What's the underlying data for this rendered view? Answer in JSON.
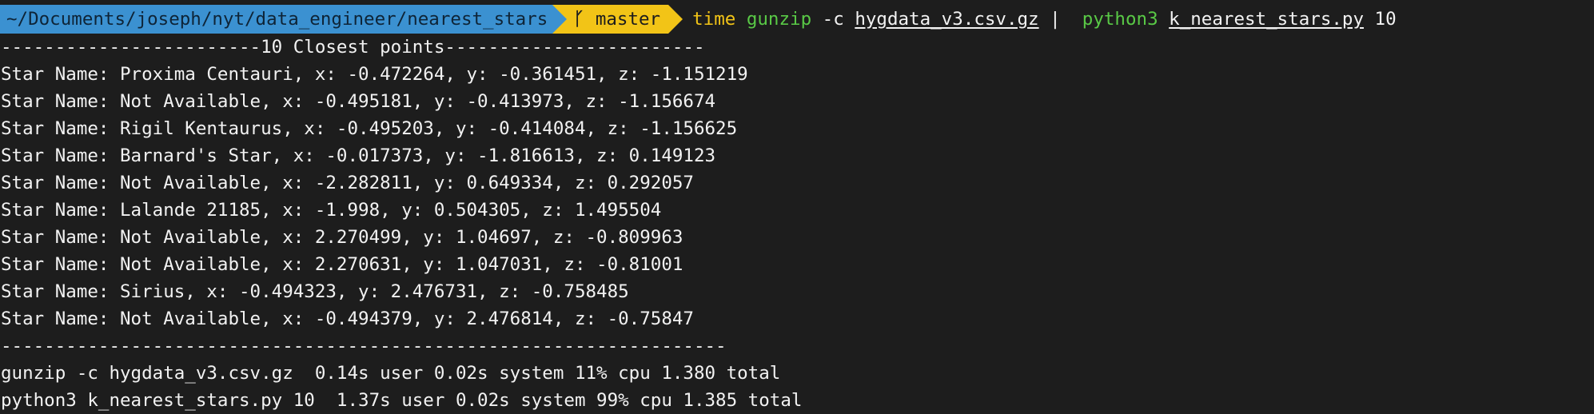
{
  "prompt": {
    "path": "~/Documents/joseph/nyt/data_engineer/nearest_stars",
    "branch": "master",
    "command": {
      "time": "time",
      "gunzip": "gunzip",
      "flag": " -c ",
      "file": "hygdata_v3.csv.gz",
      "pipe": " |  ",
      "python": "python3",
      "script": "k_nearest_stars.py",
      "arg": " 10"
    }
  },
  "output": {
    "header": "------------------------10 Closest points------------------------",
    "stars": [
      "Star Name: Proxima Centauri, x: -0.472264, y: -0.361451, z: -1.151219",
      "Star Name: Not Available, x: -0.495181, y: -0.413973, z: -1.156674",
      "Star Name: Rigil Kentaurus, x: -0.495203, y: -0.414084, z: -1.156625",
      "Star Name: Barnard's Star, x: -0.017373, y: -1.816613, z: 0.149123",
      "Star Name: Not Available, x: -2.282811, y: 0.649334, z: 0.292057",
      "Star Name: Lalande 21185, x: -1.998, y: 0.504305, z: 1.495504",
      "Star Name: Not Available, x: 2.270499, y: 1.04697, z: -0.809963",
      "Star Name: Not Available, x: 2.270631, y: 1.047031, z: -0.81001",
      "Star Name: Sirius, x: -0.494323, y: 2.476731, z: -0.758485",
      "Star Name: Not Available, x: -0.494379, y: 2.476814, z: -0.75847"
    ],
    "footer": "-------------------------------------------------------------------",
    "timing": [
      "gunzip -c hygdata_v3.csv.gz  0.14s user 0.02s system 11% cpu 1.380 total",
      "python3 k_nearest_stars.py 10  1.37s user 0.02s system 99% cpu 1.385 total"
    ]
  }
}
